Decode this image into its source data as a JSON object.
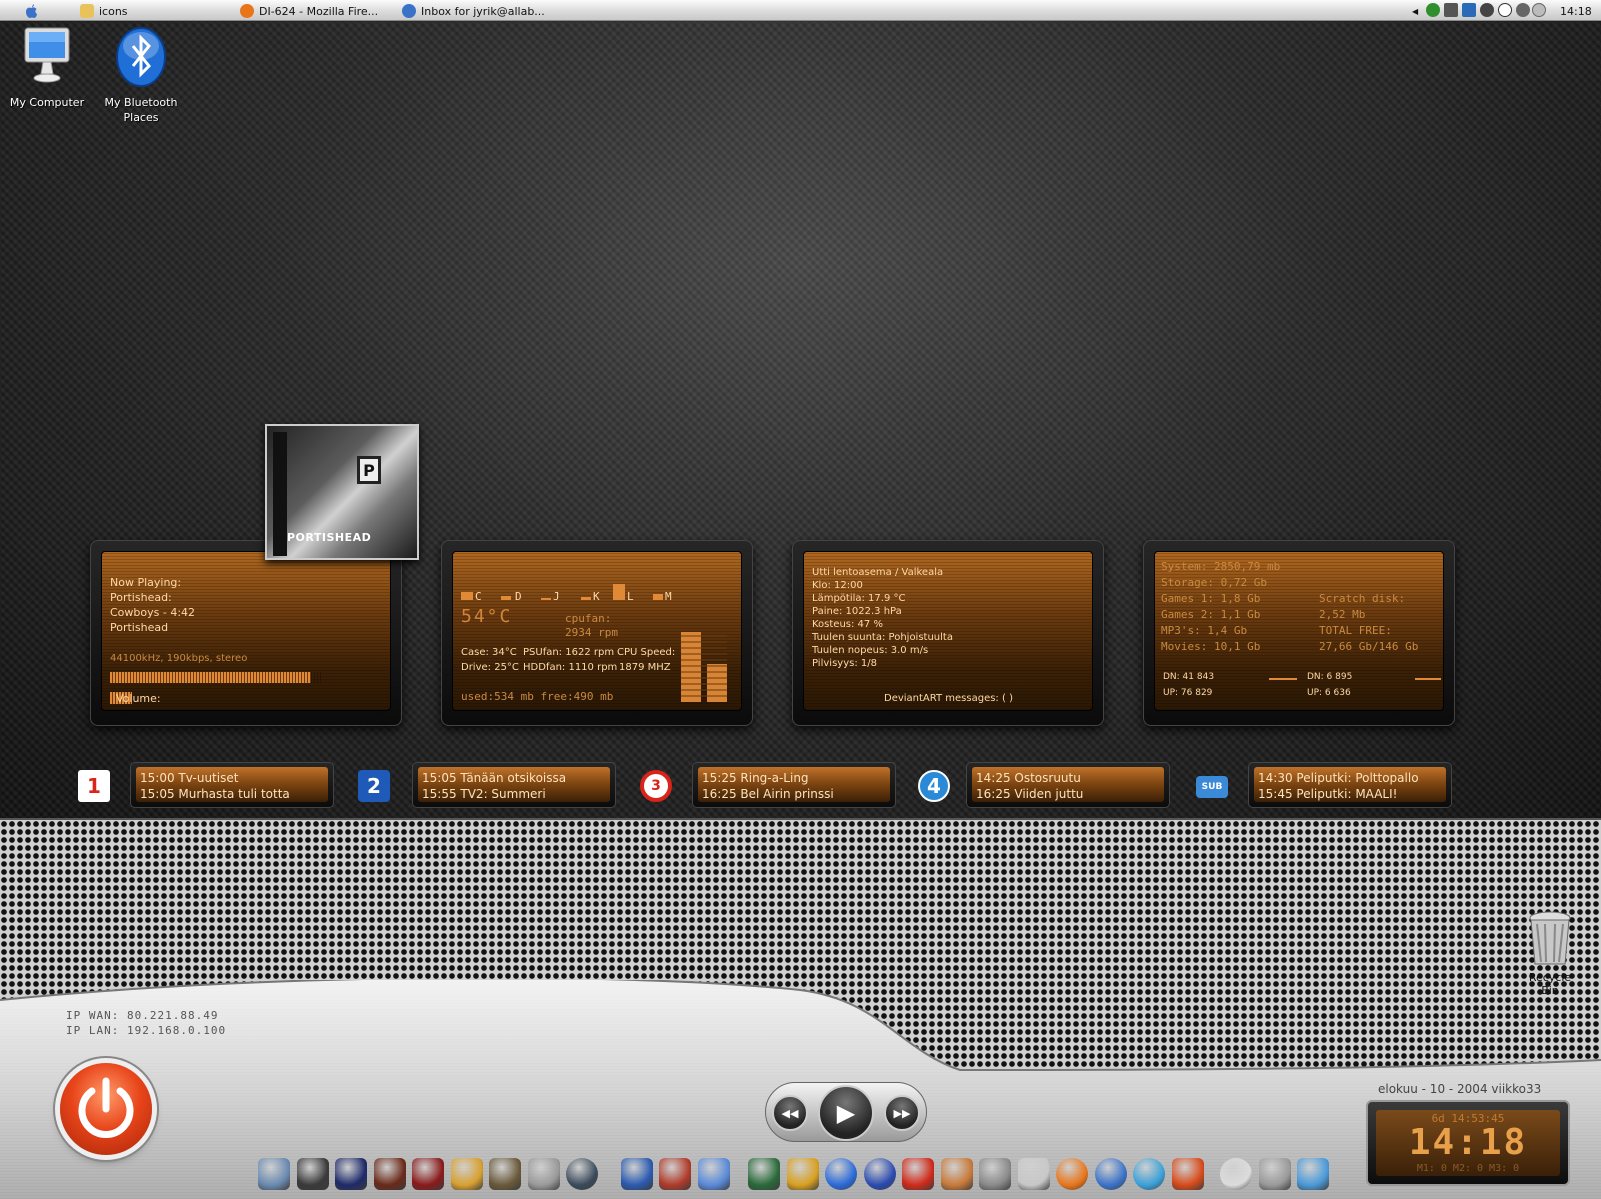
{
  "menubar": {
    "apple": "",
    "tasks": [
      {
        "label": "icons",
        "icon": "folder-icon",
        "color": "#e7c35a"
      },
      {
        "label": "DI-624 - Mozilla Fire...",
        "icon": "firefox-icon",
        "color": "#e8751a"
      },
      {
        "label": "Inbox for jyrik@allab...",
        "icon": "thunderbird-icon",
        "color": "#3a72c8"
      }
    ],
    "clock": "14:18",
    "tray": [
      {
        "icon": "leaf-icon",
        "color": "#2f8f2f"
      },
      {
        "icon": "speaker-icon",
        "color": "#555555"
      },
      {
        "icon": "network-icon",
        "color": "#2a6ab8"
      },
      {
        "icon": "gear-icon",
        "color": "#444444"
      },
      {
        "icon": "info-icon",
        "color": "#333333"
      },
      {
        "icon": "shield-icon",
        "color": "#666666"
      }
    ]
  },
  "desktop": {
    "my_computer": "My Computer",
    "bluetooth_line1": "My Bluetooth",
    "bluetooth_line2": "Places",
    "recycle": "Recycle Bin"
  },
  "nowplaying": {
    "heading": "Now Playing:",
    "artist": "Portishead:",
    "track": "Cowboys - 4:42",
    "album": "Portishead",
    "quality": "44100kHz, 190kbps, stereo",
    "volume_label": "Volume:",
    "progress": 0.95,
    "cover_text": "PORTISHEAD"
  },
  "sysmon": {
    "drive_labels": [
      "C",
      "D",
      "J",
      "K",
      "L",
      "M"
    ],
    "cpu_temp": "54°C",
    "cpufan_label": "cpufan:",
    "cpufan_rpm": "2934 rpm",
    "case": "Case: 34°C",
    "psufan": "PSUfan: 1622 rpm",
    "cpu_speed_label": "CPU Speed:",
    "drive_temp": "Drive: 25°C",
    "hddfan": "HDDfan: 1110 rpm",
    "cpu_speed": "1879 MHZ",
    "memory": "used:534 mb  free:490 mb"
  },
  "weather": {
    "station": "Utti lentoasema / Valkeala",
    "time": "Klo: 12:00",
    "temp": "Lämpötila: 17.9 °C",
    "pressure": "Paine: 1022.3 hPa",
    "humidity": "Kosteus: 47 %",
    "wind_dir": "Tuulen suunta: Pohjoistuulta",
    "wind_speed": "Tuulen nopeus: 3.0 m/s",
    "clouds": "Pilvisyys: 1/8",
    "deviantart": "DeviantART messages: ( )"
  },
  "storage": {
    "system": "System: 2850,79 mb",
    "storage": "Storage: 0,72 Gb",
    "games1": "Games 1: 1,8 Gb",
    "scratch_label": "Scratch disk:",
    "games2": "Games 2: 1,1 Gb",
    "scratch_value": "2,52 Mb",
    "mp3": "MP3's: 1,4 Gb",
    "total_label": "TOTAL FREE:",
    "movies": "Movies: 10,1 Gb",
    "total_value": "27,66 Gb/146 Gb",
    "dn1": "DN: 41 843",
    "up1": "UP: 76 829",
    "dn2": "DN: 6 895",
    "up2": "UP: 6 636"
  },
  "tv": [
    {
      "logo": "1",
      "logo_name": "yle-tv1-icon",
      "line1": "15:00 Tv-uutiset",
      "line2": "15:05 Murhasta tuli totta"
    },
    {
      "logo": "2",
      "logo_name": "yle-tv2-icon",
      "line1": "15:05 Tänään otsikoissa",
      "line2": "15:55 TV2: Summeri"
    },
    {
      "logo": "3",
      "logo_name": "mtv3-icon",
      "line1": "15:25 Ring-a-Ling",
      "line2": "16:25 Bel Airin prinssi"
    },
    {
      "logo": "4",
      "logo_name": "nelonen-icon",
      "line1": "14:25 Ostosruutu",
      "line2": "16:25 Viiden juttu"
    },
    {
      "logo": "SUB",
      "logo_name": "subtv-icon",
      "line1": "14:30 Peliputki: Polttopallo",
      "line2": "15:45 Peliputki: MAALI!"
    }
  ],
  "network": {
    "wan": "IP WAN: 80.221.88.49",
    "lan": "IP LAN: 192.168.0.100"
  },
  "clockwidget": {
    "date": "elokuu - 10 - 2004 viikko33",
    "uptime": "6d 14:53:45",
    "time": "14:18",
    "mems": "M1: 0  M2: 0  M3: 0"
  },
  "media": {
    "prev": "◀◀",
    "play": "▶",
    "next": "▶▶"
  },
  "dock": [
    {
      "name": "character-icon",
      "color": "#6a8ab0"
    },
    {
      "name": "trainer-icon",
      "color": "#3a3a3a"
    },
    {
      "name": "game-icon",
      "color": "#1e2a6a"
    },
    {
      "name": "quake-icon",
      "color": "#6a2a1a"
    },
    {
      "name": "wolfenstein-icon",
      "color": "#8a1a1a"
    },
    {
      "name": "unreal-icon",
      "color": "#d8a030"
    },
    {
      "name": "warrior-icon",
      "color": "#6a5a3a"
    },
    {
      "name": "halo-icon",
      "color": "#9a9a9a"
    },
    {
      "name": "soldier-icon",
      "color": "#3a4a5a"
    },
    {
      "name": "pen-icon",
      "color": "#2a5ab0"
    },
    {
      "name": "spiral-icon",
      "color": "#b03a2a"
    },
    {
      "name": "notes-icon",
      "color": "#5a8ad8"
    },
    {
      "name": "eye-icon",
      "color": "#2a6a3a"
    },
    {
      "name": "winamp-icon",
      "color": "#d8a020"
    },
    {
      "name": "ie-icon",
      "color": "#2a6ad8"
    },
    {
      "name": "bittorrent-icon",
      "color": "#2a4ab0"
    },
    {
      "name": "superman-icon",
      "color": "#d02a1a"
    },
    {
      "name": "emule-icon",
      "color": "#c87a3a"
    },
    {
      "name": "calculator-icon",
      "color": "#8a8a8a"
    },
    {
      "name": "notepad-icon",
      "color": "#c8c8c8"
    },
    {
      "name": "firefox-icon",
      "color": "#e8751a"
    },
    {
      "name": "thunderbird-icon",
      "color": "#3a72c8"
    },
    {
      "name": "cd-icon",
      "color": "#3aa0d8"
    },
    {
      "name": "nero-icon",
      "color": "#d84a1a"
    },
    {
      "name": "clock-icon",
      "color": "#dcdcdc"
    },
    {
      "name": "trash-icon",
      "color": "#9a9a9a"
    },
    {
      "name": "download-icon",
      "color": "#4a9ad8"
    }
  ]
}
